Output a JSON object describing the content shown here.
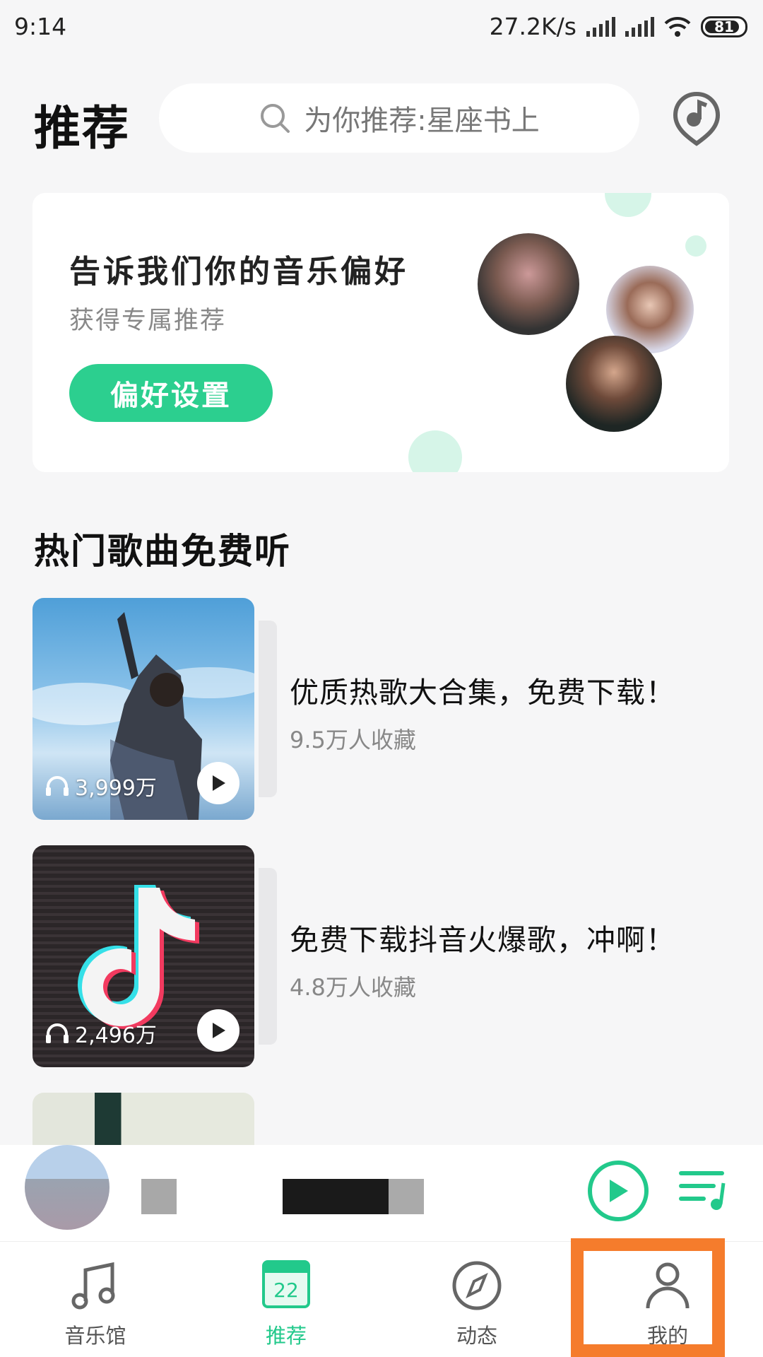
{
  "status_bar": {
    "time": "9:14",
    "net_speed": "27.2K/s",
    "battery": "81"
  },
  "header": {
    "title": "推荐",
    "search_placeholder": "为你推荐:星座书上"
  },
  "preference_card": {
    "title": "告诉我们你的音乐偏好",
    "subtitle": "获得专属推荐",
    "button_label": "偏好设置"
  },
  "section": {
    "title": "热门歌曲免费听"
  },
  "playlists": [
    {
      "title": "优质热歌大合集，免费下载！",
      "favorites": "9.5万人收藏",
      "play_count": "3,999万"
    },
    {
      "title": "免费下载抖音火爆歌，冲啊！",
      "favorites": "4.8万人收藏",
      "play_count": "2,496万"
    }
  ],
  "tabs": [
    {
      "label": "音乐馆",
      "icon": "music-note-icon"
    },
    {
      "label": "推荐",
      "icon": "calendar-icon",
      "badge": "22"
    },
    {
      "label": "动态",
      "icon": "compass-icon"
    },
    {
      "label": "我的",
      "icon": "user-icon"
    }
  ],
  "colors": {
    "accent": "#22c98b",
    "highlight": "#f57c2c"
  }
}
